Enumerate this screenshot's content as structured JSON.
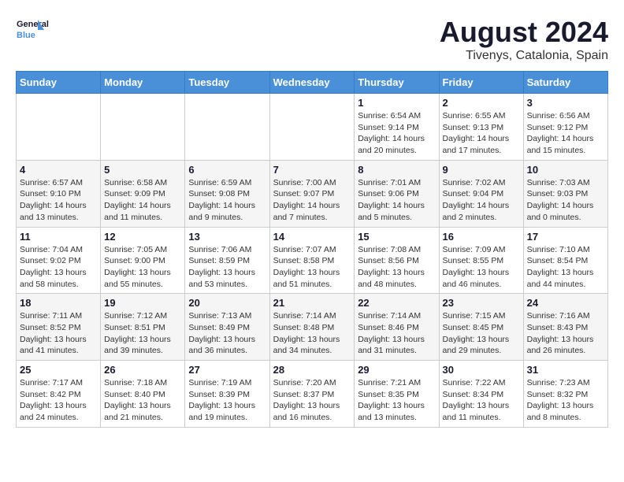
{
  "logo": {
    "text_general": "General",
    "text_blue": "Blue"
  },
  "header": {
    "month_year": "August 2024",
    "location": "Tivenys, Catalonia, Spain"
  },
  "weekdays": [
    "Sunday",
    "Monday",
    "Tuesday",
    "Wednesday",
    "Thursday",
    "Friday",
    "Saturday"
  ],
  "weeks": [
    [
      {
        "day": "",
        "info": ""
      },
      {
        "day": "",
        "info": ""
      },
      {
        "day": "",
        "info": ""
      },
      {
        "day": "",
        "info": ""
      },
      {
        "day": "1",
        "info": "Sunrise: 6:54 AM\nSunset: 9:14 PM\nDaylight: 14 hours\nand 20 minutes."
      },
      {
        "day": "2",
        "info": "Sunrise: 6:55 AM\nSunset: 9:13 PM\nDaylight: 14 hours\nand 17 minutes."
      },
      {
        "day": "3",
        "info": "Sunrise: 6:56 AM\nSunset: 9:12 PM\nDaylight: 14 hours\nand 15 minutes."
      }
    ],
    [
      {
        "day": "4",
        "info": "Sunrise: 6:57 AM\nSunset: 9:10 PM\nDaylight: 14 hours\nand 13 minutes."
      },
      {
        "day": "5",
        "info": "Sunrise: 6:58 AM\nSunset: 9:09 PM\nDaylight: 14 hours\nand 11 minutes."
      },
      {
        "day": "6",
        "info": "Sunrise: 6:59 AM\nSunset: 9:08 PM\nDaylight: 14 hours\nand 9 minutes."
      },
      {
        "day": "7",
        "info": "Sunrise: 7:00 AM\nSunset: 9:07 PM\nDaylight: 14 hours\nand 7 minutes."
      },
      {
        "day": "8",
        "info": "Sunrise: 7:01 AM\nSunset: 9:06 PM\nDaylight: 14 hours\nand 5 minutes."
      },
      {
        "day": "9",
        "info": "Sunrise: 7:02 AM\nSunset: 9:04 PM\nDaylight: 14 hours\nand 2 minutes."
      },
      {
        "day": "10",
        "info": "Sunrise: 7:03 AM\nSunset: 9:03 PM\nDaylight: 14 hours\nand 0 minutes."
      }
    ],
    [
      {
        "day": "11",
        "info": "Sunrise: 7:04 AM\nSunset: 9:02 PM\nDaylight: 13 hours\nand 58 minutes."
      },
      {
        "day": "12",
        "info": "Sunrise: 7:05 AM\nSunset: 9:00 PM\nDaylight: 13 hours\nand 55 minutes."
      },
      {
        "day": "13",
        "info": "Sunrise: 7:06 AM\nSunset: 8:59 PM\nDaylight: 13 hours\nand 53 minutes."
      },
      {
        "day": "14",
        "info": "Sunrise: 7:07 AM\nSunset: 8:58 PM\nDaylight: 13 hours\nand 51 minutes."
      },
      {
        "day": "15",
        "info": "Sunrise: 7:08 AM\nSunset: 8:56 PM\nDaylight: 13 hours\nand 48 minutes."
      },
      {
        "day": "16",
        "info": "Sunrise: 7:09 AM\nSunset: 8:55 PM\nDaylight: 13 hours\nand 46 minutes."
      },
      {
        "day": "17",
        "info": "Sunrise: 7:10 AM\nSunset: 8:54 PM\nDaylight: 13 hours\nand 44 minutes."
      }
    ],
    [
      {
        "day": "18",
        "info": "Sunrise: 7:11 AM\nSunset: 8:52 PM\nDaylight: 13 hours\nand 41 minutes."
      },
      {
        "day": "19",
        "info": "Sunrise: 7:12 AM\nSunset: 8:51 PM\nDaylight: 13 hours\nand 39 minutes."
      },
      {
        "day": "20",
        "info": "Sunrise: 7:13 AM\nSunset: 8:49 PM\nDaylight: 13 hours\nand 36 minutes."
      },
      {
        "day": "21",
        "info": "Sunrise: 7:14 AM\nSunset: 8:48 PM\nDaylight: 13 hours\nand 34 minutes."
      },
      {
        "day": "22",
        "info": "Sunrise: 7:14 AM\nSunset: 8:46 PM\nDaylight: 13 hours\nand 31 minutes."
      },
      {
        "day": "23",
        "info": "Sunrise: 7:15 AM\nSunset: 8:45 PM\nDaylight: 13 hours\nand 29 minutes."
      },
      {
        "day": "24",
        "info": "Sunrise: 7:16 AM\nSunset: 8:43 PM\nDaylight: 13 hours\nand 26 minutes."
      }
    ],
    [
      {
        "day": "25",
        "info": "Sunrise: 7:17 AM\nSunset: 8:42 PM\nDaylight: 13 hours\nand 24 minutes."
      },
      {
        "day": "26",
        "info": "Sunrise: 7:18 AM\nSunset: 8:40 PM\nDaylight: 13 hours\nand 21 minutes."
      },
      {
        "day": "27",
        "info": "Sunrise: 7:19 AM\nSunset: 8:39 PM\nDaylight: 13 hours\nand 19 minutes."
      },
      {
        "day": "28",
        "info": "Sunrise: 7:20 AM\nSunset: 8:37 PM\nDaylight: 13 hours\nand 16 minutes."
      },
      {
        "day": "29",
        "info": "Sunrise: 7:21 AM\nSunset: 8:35 PM\nDaylight: 13 hours\nand 13 minutes."
      },
      {
        "day": "30",
        "info": "Sunrise: 7:22 AM\nSunset: 8:34 PM\nDaylight: 13 hours\nand 11 minutes."
      },
      {
        "day": "31",
        "info": "Sunrise: 7:23 AM\nSunset: 8:32 PM\nDaylight: 13 hours\nand 8 minutes."
      }
    ]
  ]
}
